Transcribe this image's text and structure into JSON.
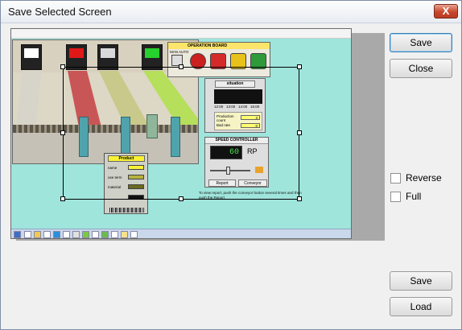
{
  "window": {
    "title": "Save Selected Screen",
    "close_glyph": "X"
  },
  "buttons": {
    "save_top": "Save",
    "close": "Close",
    "save_bottom": "Save",
    "load": "Load"
  },
  "options": {
    "reverse_label": "Reverse",
    "reverse_checked": false,
    "full_label": "Full",
    "full_checked": false
  },
  "preview": {
    "operation_board": {
      "title": "OPERATION    BOARD",
      "mode_labels": [
        "MAN",
        "AUTO"
      ],
      "lamp_colors": [
        "#d42a2a",
        "#e8c21a",
        "#2e9a3a"
      ]
    },
    "situation": {
      "title": "situation",
      "time_ticks": [
        "12:00",
        "13:00",
        "14:00",
        "15:00"
      ],
      "production_count_label": "Production count",
      "production_count": "3",
      "bad_rate_label": "Bad rate",
      "bad_rate": "0"
    },
    "speed_controller": {
      "title": "SPEED CONTROLLER",
      "value": "60",
      "unit": "RP",
      "slider_level": 0.45,
      "report_button": "Report",
      "conveyor_button": "Conveyor",
      "report_text": "To view report, push the conveyor button several times and then push the Report"
    },
    "product": {
      "title": "Product",
      "name_label": "name",
      "use_term_label": "use term",
      "material_label": "material"
    },
    "lane_colors": [
      "#d7d4ca",
      "#c95656",
      "#c8c98b",
      "#b6df5b"
    ],
    "door_lamps": [
      "#ffffff",
      "#e11818",
      "#d9d9d9",
      "#27d12e"
    ]
  }
}
